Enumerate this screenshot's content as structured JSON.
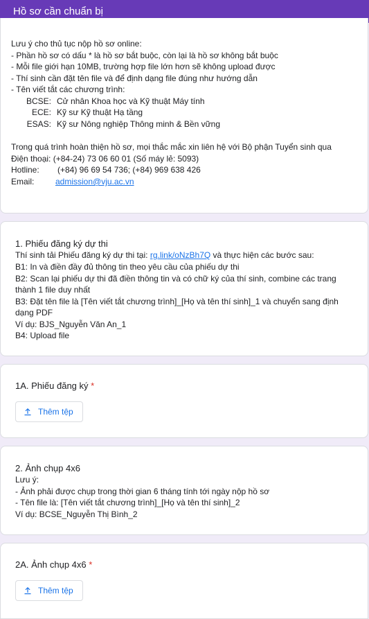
{
  "header": {
    "title": "Hồ sơ cần chuẩn bị"
  },
  "intro": {
    "lines": [
      "Lưu ý cho thủ tục nộp hồ sơ online:",
      "- Phần hồ sơ có dấu * là hồ sơ bắt buộc, còn lại là hồ sơ không bắt buộc",
      "- Mỗi file giới hạn 10MB, trường hợp file lớn hơn sẽ không upload được",
      "- Thí sinh cần đặt tên file và để định dạng file đúng như hướng dẫn",
      "- Tên viết tắt các chương trình:"
    ],
    "programs": [
      {
        "code": "BCSE:",
        "name": "Cử nhân Khoa học và Kỹ thuật Máy tính"
      },
      {
        "code": "ECE:",
        "name": "Kỹ sư Kỹ thuật Hạ tầng"
      },
      {
        "code": "ESAS:",
        "name": "Kỹ sư Nông nghiệp Thông minh & Bền vững"
      }
    ],
    "contact_intro": "Trong quá trình hoàn thiện hồ sơ, mọi thắc mắc xin liên hệ với Bộ phận Tuyển sinh qua",
    "phone_label": "Điện thoại:",
    "phone_value": "(+84-24) 73 06 60 01 (Số máy lẻ: 5093)",
    "hotline_label": "Hotline:",
    "hotline_value": "(+84) 96 69 54 736; (+84) 969 638 426",
    "email_label": "Email:",
    "email_value": "admission@vju.ac.vn"
  },
  "section1": {
    "title": "1. Phiếu đăng ký dự thi",
    "line1_pre": "Thí sinh tải Phiếu đăng ký dự thi tại:",
    "line1_link": "rg.link/oNzBh7Q",
    "line1_post": "và thực hiện các bước sau:",
    "steps": [
      "B1: In và điền đầy đủ thông tin theo yêu cầu của phiếu dự thi",
      "B2: Scan lại phiếu dự thi đã điền thông tin và có chữ ký của thí sinh, combine các trang",
      "thành 1 file duy nhất",
      "B3: Đặt tên file là [Tên viết tắt chương trình]_[Họ và tên thí sinh]_1 và chuyển sang định",
      "dạng PDF",
      "Ví dụ: BJS_Nguyễn Văn An_1",
      "B4: Upload file"
    ]
  },
  "q1a": {
    "title": "1A. Phiếu đăng ký",
    "required": "*",
    "button": "Thêm tệp"
  },
  "section2": {
    "title": "2. Ảnh chụp 4x6",
    "lines": [
      "Lưu ý:",
      "- Ảnh phải được chụp trong thời gian 6 tháng tính tới ngày nộp hồ sơ",
      "- Tên file là:  [Tên viết tắt chương trình]_[Họ và tên thí sinh]_2",
      "Ví dụ: BCSE_Nguyễn Thị Bình_2"
    ]
  },
  "q2a": {
    "title": "2A. Ảnh chụp 4x6",
    "required": "*",
    "button": "Thêm tệp"
  }
}
